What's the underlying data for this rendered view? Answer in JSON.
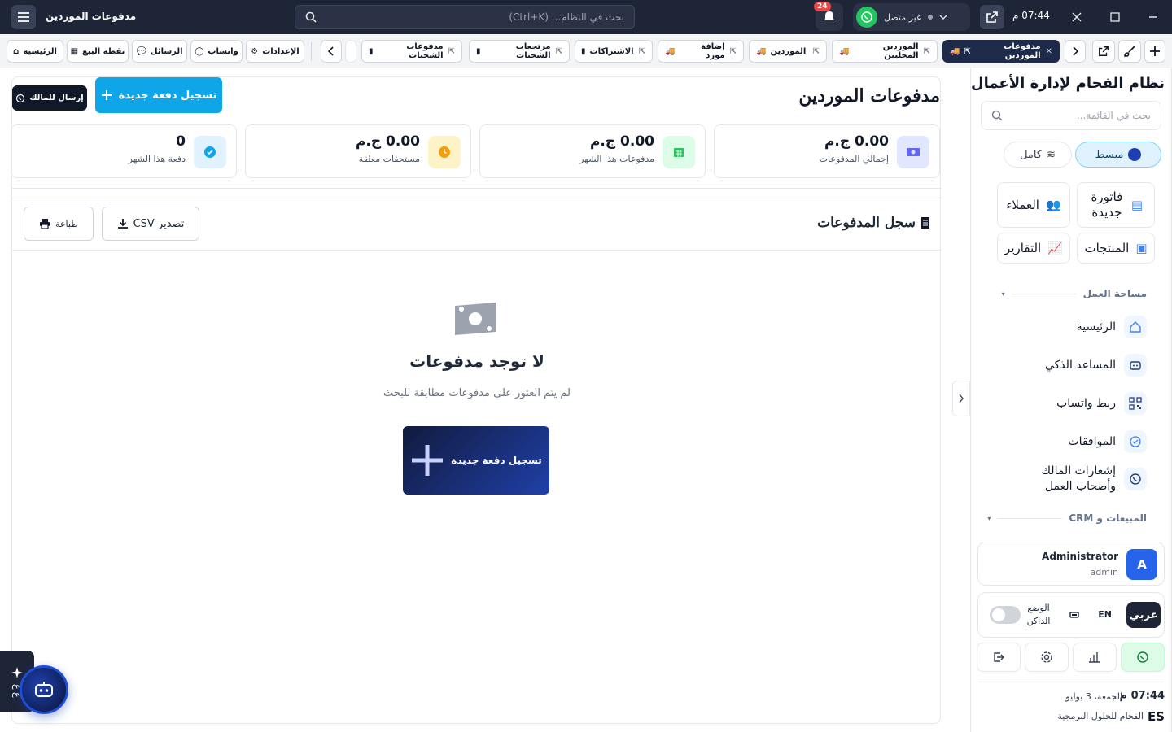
{
  "topbar": {
    "time": "07:44 م",
    "wa_status": "غير متصل",
    "bell_count": "24",
    "search_placeholder": "بحث في النظام... (Ctrl+K)",
    "title": "مدفوعات الموردين"
  },
  "tabs": [
    {
      "label": "مدفوعات الموردين",
      "active": true
    },
    {
      "label": "الموردين المحليين"
    },
    {
      "label": "الموردين"
    },
    {
      "label": "إضافة مورد"
    },
    {
      "label": "الاشتراكات"
    },
    {
      "label": "مرتجعات الشحنات"
    },
    {
      "label": "مدفوعات الشحنات"
    }
  ],
  "quick_links": {
    "settings": "الإعدادات",
    "whatsapp": "واتساب",
    "messages": "الرسائل",
    "pos": "نقطة البيع",
    "home": "الرئيسية"
  },
  "sidebar": {
    "title": "نظام الفحام لإدارة الأعمال",
    "search_placeholder": "بحث في القائمة...",
    "mode_simple": "مبسط",
    "mode_full": "كامل",
    "quick_actions": {
      "new_invoice": "فاتورة جديدة",
      "customers": "العملاء",
      "products": "المنتجات",
      "reports": "التقارير"
    },
    "section_workspace": "مساحة العمل",
    "section_sales": "المبيعات و CRM",
    "nav": {
      "home": "الرئيسية",
      "assistant": "المساعد الذكي",
      "wa_link": "ربط واتساب",
      "approvals": "الموافقات",
      "owner_notify": "إشعارات المالك وأصحاب العمل"
    },
    "user_name": "Administrator",
    "user_role": "admin",
    "avatar": "A",
    "lang_ar": "عربي",
    "lang_en": "EN",
    "dark_mode": "الوضع الداكن",
    "time": "07:44 م",
    "date": "الجمعة، 3 يوليو",
    "company": "الفحام للحلول البرمجية",
    "logo": "ES"
  },
  "main": {
    "page_title": "مدفوعات الموردين",
    "new_payment": "تسجيل دفعة جديدة",
    "send_owner": "إرسال للمالك",
    "stats": [
      {
        "value": "0.00 ج.م",
        "label": "إجمالي المدفوعات",
        "color": "#6366f1"
      },
      {
        "value": "0.00 ج.م",
        "label": "مدفوعات هذا الشهر",
        "color": "#22c55e"
      },
      {
        "value": "0.00 ج.م",
        "label": "مستحقات معلقة",
        "color": "#f59e0b"
      },
      {
        "value": "0",
        "label": "دفعة هذا الشهر",
        "color": "#0ea5e9"
      }
    ],
    "log_title": "سجل المدفوعات",
    "export_csv": "تصدير CSV",
    "print": "طباعة",
    "empty_title": "لا توجد مدفوعات",
    "empty_sub": "لم يتم العثور على مدفوعات مطابقة للبحث",
    "empty_btn": "تسجيل دفعة جديدة"
  },
  "ai_float_label": "ع ع"
}
